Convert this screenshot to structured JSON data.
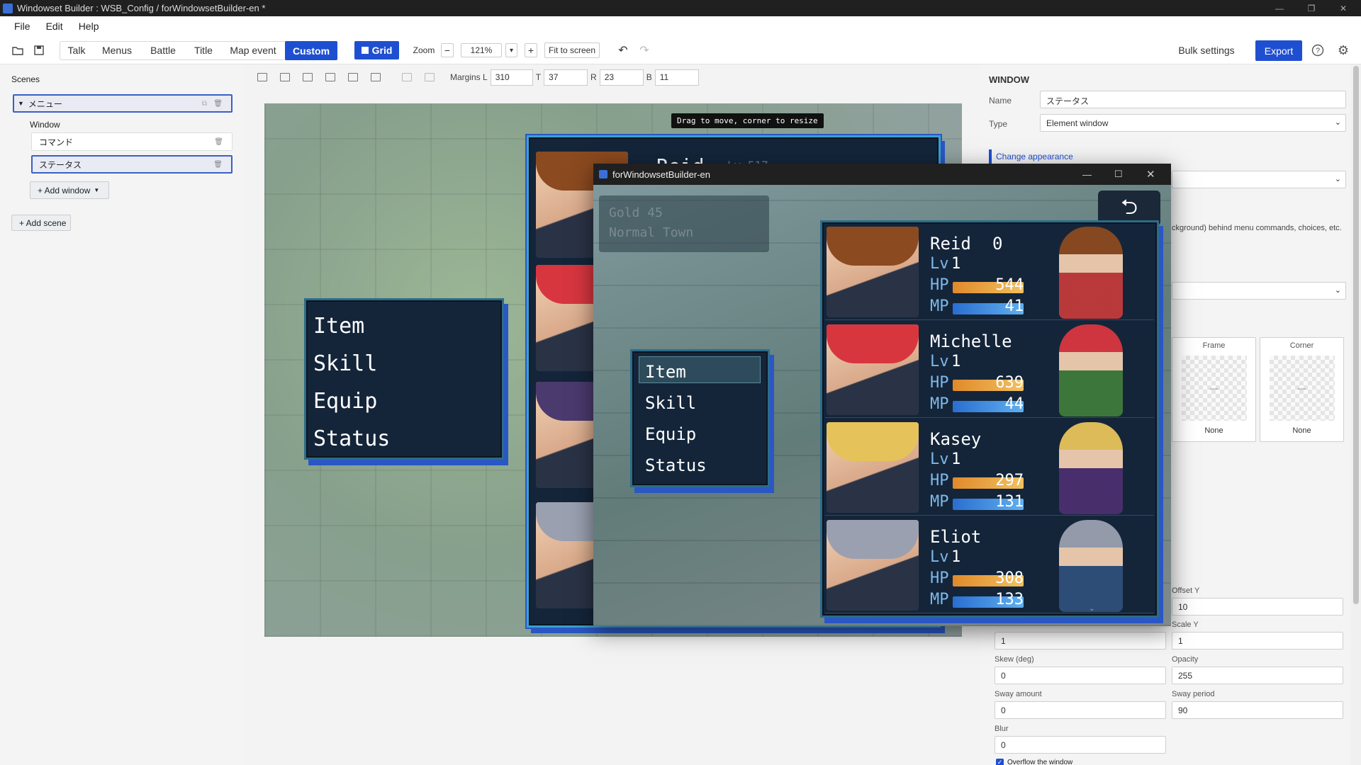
{
  "app": {
    "title": "Windowset Builder : WSB_Config / forWindowsetBuilder-en *"
  },
  "menu": [
    "File",
    "Edit",
    "Help"
  ],
  "toolbar": {
    "tabs": [
      "Talk",
      "Menus",
      "Battle",
      "Title",
      "Map event",
      "Custom"
    ],
    "grid_label": "Grid",
    "zoom_label": "Zoom",
    "zoom_minus": "−",
    "zoom_value": "121%",
    "zoom_plus": "+",
    "fit_label": "Fit to screen",
    "bulk_label": "Bulk settings",
    "export_label": "Export",
    "accent": "#1f4fd1"
  },
  "scenes": {
    "header": "Scenes",
    "scene_name": "メニュー",
    "window_header": "Window",
    "windows": [
      "コマンド",
      "ステータス"
    ],
    "add_window": "+ Add window",
    "add_scene": "+ Add scene"
  },
  "align": {
    "margins_label": "Margins L",
    "L": "310",
    "T_label": "T",
    "T": "37",
    "R_label": "R",
    "R": "23",
    "B_label": "B",
    "B": "11"
  },
  "canvas": {
    "tooltip": "Drag to move, corner to resize",
    "peek_name": "Reid",
    "peek_level": "Lv 517",
    "commands": [
      "Item",
      "Skill",
      "Equip",
      "Status"
    ]
  },
  "preview": {
    "title": "forWindowsetBuilder-en",
    "gold": "Gold 45",
    "location": "Normal Town",
    "commands": [
      "Item",
      "Skill",
      "Equip",
      "Status"
    ],
    "lv_label": "Lv",
    "hp_label": "HP",
    "mp_label": "MP",
    "actors": [
      {
        "name": "Reid",
        "extra": "0",
        "lv": "1",
        "hp": "544",
        "mp": "41",
        "hp_fill": 1.0,
        "mp_fill": 1.0,
        "hair": "#8b4a1f",
        "outfit": "#c23a3a"
      },
      {
        "name": "Michelle",
        "extra": "",
        "lv": "1",
        "hp": "639",
        "mp": "44",
        "hp_fill": 1.0,
        "mp_fill": 1.0,
        "hair": "#d8363f",
        "outfit": "#3f7a3a"
      },
      {
        "name": "Kasey",
        "extra": "",
        "lv": "1",
        "hp": "297",
        "mp": "131",
        "hp_fill": 1.0,
        "mp_fill": 1.0,
        "hair": "#e6c35a",
        "outfit": "#4b2f6e"
      },
      {
        "name": "Eliot",
        "extra": "",
        "lv": "1",
        "hp": "308",
        "mp": "133",
        "hp_fill": 1.0,
        "mp_fill": 1.0,
        "hair": "#9aa0b0",
        "outfit": "#2e4f7a"
      }
    ]
  },
  "props": {
    "section": "WINDOW",
    "name_label": "Name",
    "name_value": "ステータス",
    "type_label": "Type",
    "type_value": "Element window",
    "change_appearance": "Change appearance",
    "bg_desc": "ckground) behind menu commands, choices, etc.",
    "frame_label": "Frame",
    "frame_value": "None",
    "corner_label": "Corner",
    "corner_value": "None",
    "offset_y_label": "Offset Y",
    "offset_y": "10",
    "scale_x": "1",
    "scale_y_label": "Scale Y",
    "scale_y": "1",
    "skew_label": "Skew (deg)",
    "skew": "0",
    "opacity_label": "Opacity",
    "opacity": "255",
    "sway_amount_label": "Sway amount",
    "sway_amount": "0",
    "sway_period_label": "Sway period",
    "sway_period": "90",
    "blur_label": "Blur",
    "blur": "0",
    "overflow_label": "Overflow the window"
  }
}
